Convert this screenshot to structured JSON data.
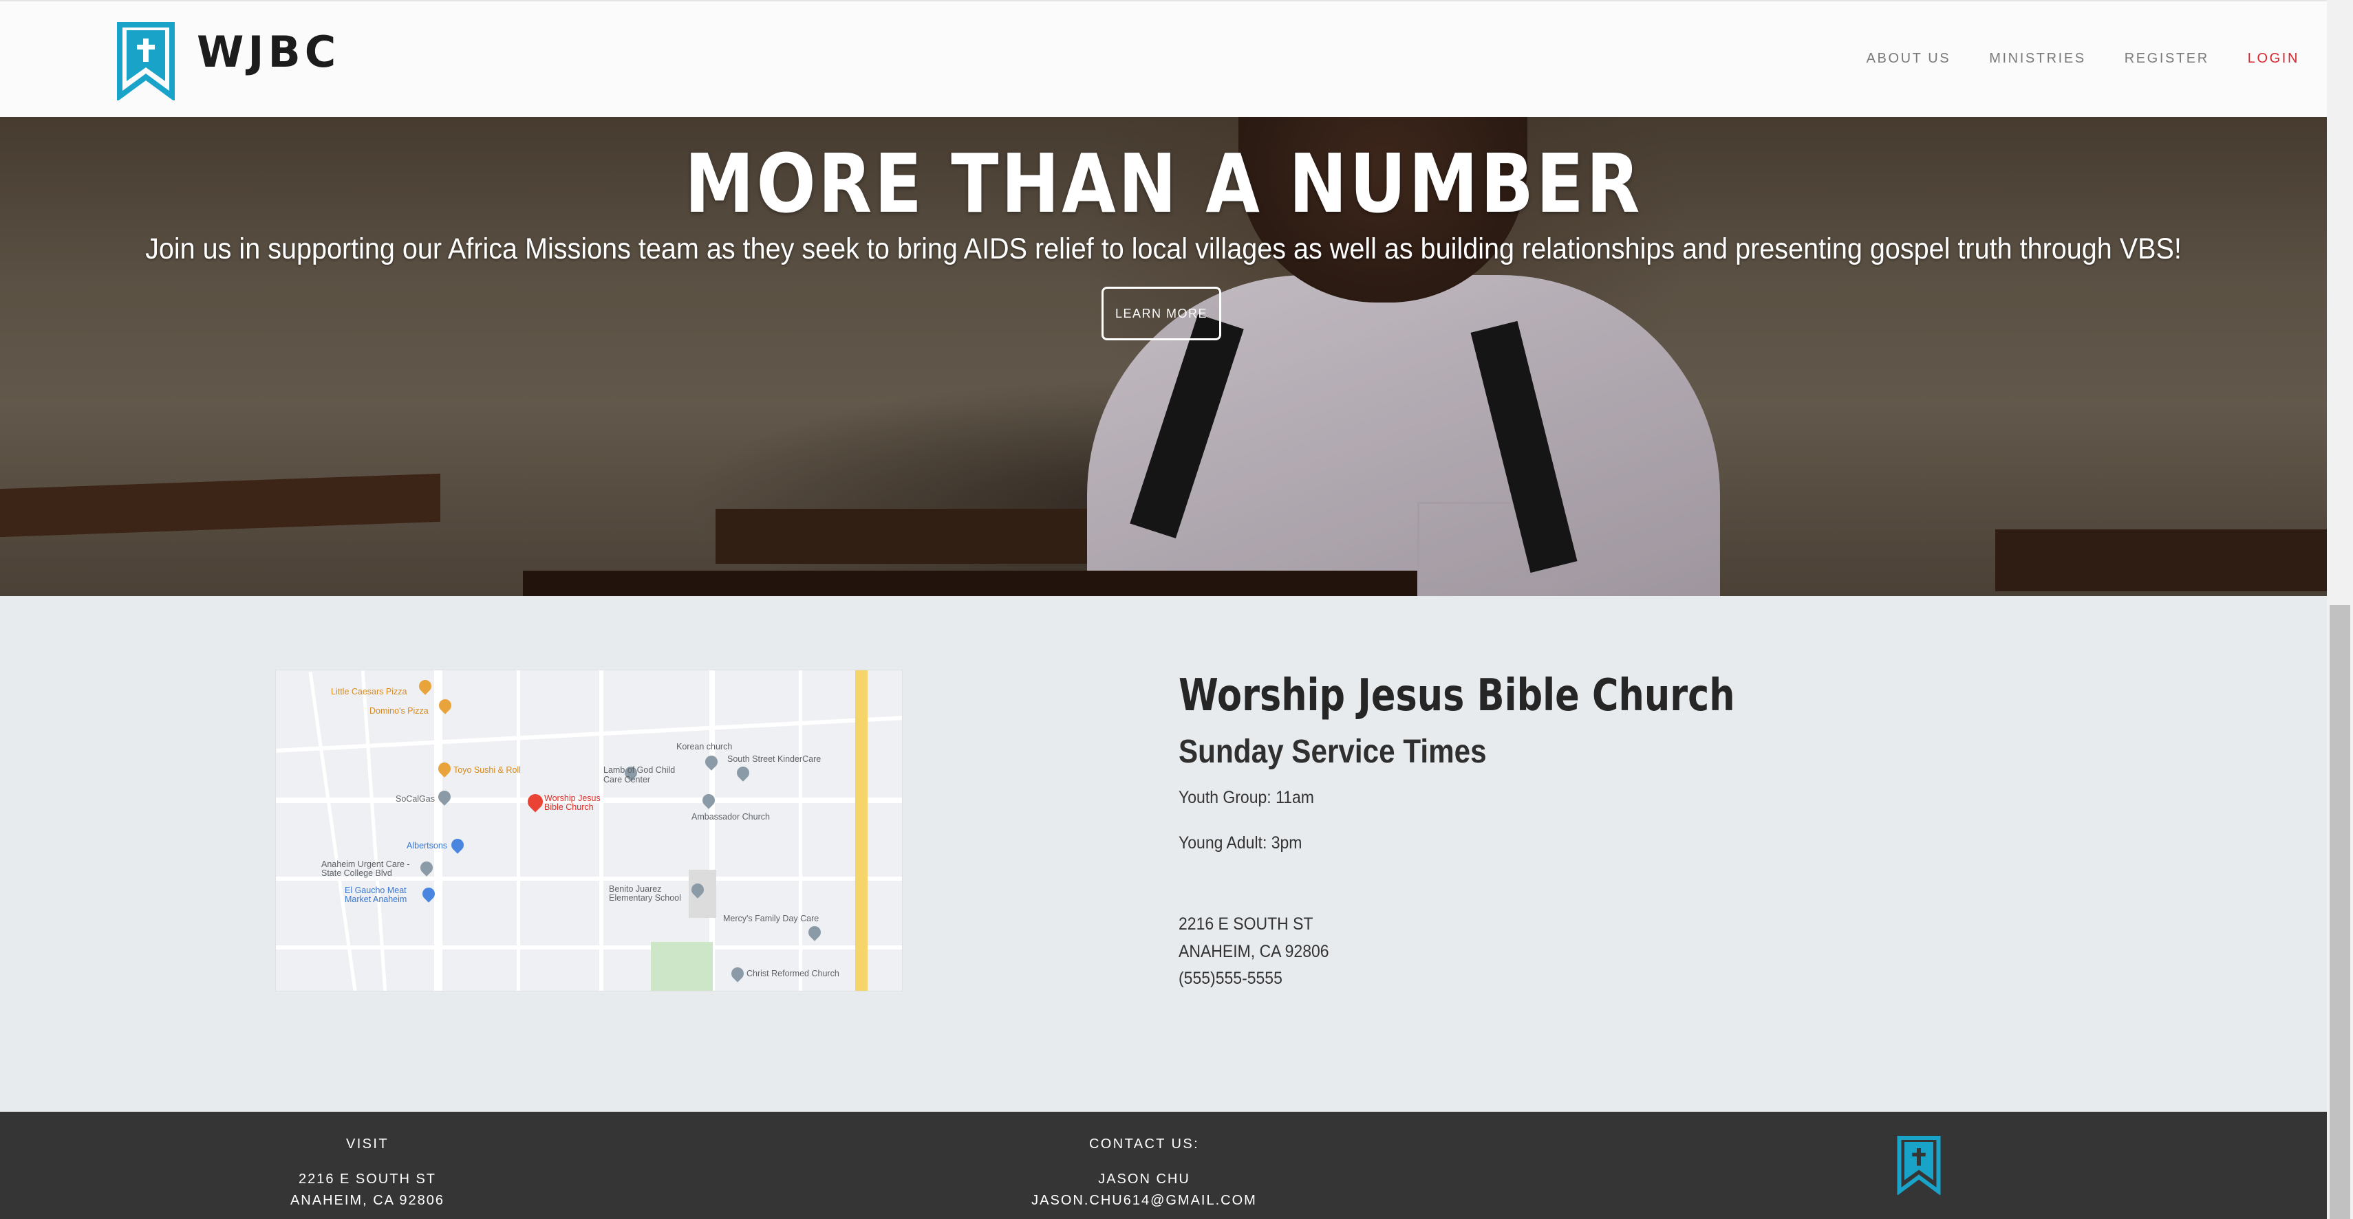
{
  "header": {
    "logo_text": "WJBC",
    "nav": [
      {
        "label": "ABOUT US"
      },
      {
        "label": "MINISTRIES"
      },
      {
        "label": "REGISTER"
      },
      {
        "label": "LOGIN"
      }
    ]
  },
  "hero": {
    "title": "MORE THAN A NUMBER",
    "subtitle": "Join us in supporting our Africa Missions team as they seek to bring AIDS relief to local villages as well as building relationships and presenting gospel truth through VBS!",
    "button": "LEARN MORE"
  },
  "map": {
    "labels": [
      "Little Caesars Pizza",
      "Domino's Pizza",
      "Toyo Sushi & Roll",
      "SoCalGas",
      "Worship Jesus Bible Church",
      "Lamb of God Child Care Center",
      "Korean church",
      "South Street KinderCare",
      "Ambassador Church",
      "Albertsons",
      "Anaheim Urgent Care - State College Blvd",
      "El Gaucho Meat Market Anaheim",
      "Benito Juarez Elementary School",
      "Mercy's Family Day Care",
      "Christ Reformed Church"
    ]
  },
  "info": {
    "church_name": "Worship Jesus Bible Church",
    "service_heading": "Sunday Service Times",
    "youth_group": "Youth Group: 11am",
    "young_adult": "Young Adult: 3pm",
    "address_line1": "2216 E SOUTH ST",
    "address_line2": "ANAHEIM, CA 92806",
    "phone": "(555)555-5555"
  },
  "footer": {
    "visit": {
      "heading": "VISIT",
      "line1": "2216 E SOUTH ST",
      "line2": "ANAHEIM, CA 92806"
    },
    "contact": {
      "heading": "CONTACT US:",
      "line1": "JASON CHU",
      "line2": "JASON.CHU614@GMAIL.COM"
    }
  },
  "colors": {
    "brand": "#1aa3c9",
    "login": "#d7272d",
    "footer_bg": "#353535",
    "section_bg": "#e8ebee"
  }
}
